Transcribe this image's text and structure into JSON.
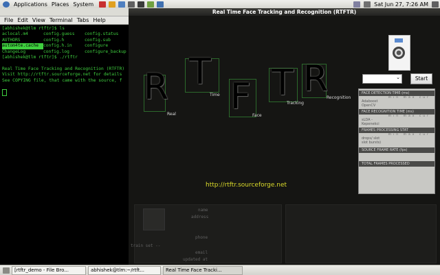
{
  "top_panel": {
    "menus": [
      "Applications",
      "Places",
      "System"
    ],
    "clock": "Sat Jun 27,  7:26 AM"
  },
  "terminal": {
    "menu": [
      "File",
      "Edit",
      "View",
      "Terminal",
      "Tabs",
      "Help"
    ],
    "prompt1": "[abhishek@tlm rtftr]$ ls",
    "ls": [
      [
        "aclocal.m4",
        "config.guess",
        "config.status"
      ],
      [
        "AUTHORS",
        "config.h",
        "config.sub"
      ],
      [
        "autom4te.cache",
        "config.h.in",
        "configure"
      ],
      [
        "ChangeLog",
        "config.log",
        "configure_backup"
      ]
    ],
    "prompt2": "[abhishek@tlm rtftr]$ ./rtftr",
    "out": [
      "Real Time Face Tracking and Recognition (RTFTR)",
      "Visit http://rtftr.sourceforge.net for details",
      "See COPYING file, that came with the source, f"
    ]
  },
  "app": {
    "title": "Real Time Face Tracking and Recognition (RTFTR)",
    "letters": [
      "R",
      "T",
      "F",
      "T",
      "R"
    ],
    "words": [
      "Real",
      "Time",
      "Face",
      "Tracking",
      "Recognition"
    ],
    "url": "http://rtftr.sourceforge.net",
    "start": "Start",
    "stats": {
      "h1": "FACE DETECTION TIME (ms)",
      "cols": "min  max  cur",
      "r1a": "Adaboost",
      "r1b": "OpenCV",
      "h2": "FACE RECOGNITION TIME (ms)",
      "r2a": "sLDA -",
      "r2b": "Kepenekci",
      "h3": "FRAMES PROCESSING STAT",
      "r3a": "drops/ slot",
      "r3b": "slot bursts)",
      "h4": "SOURCE FRAME RATE (fps)",
      "h5": "TOTAL FRAMES PROCESSED"
    },
    "form": {
      "name": "name",
      "address": "address",
      "phone": "phone",
      "email": "email",
      "updated": "updated at",
      "train": "train set --"
    }
  },
  "taskbar": [
    "[rtftr_demo - File Bro...",
    "abhishek@tlm:~/rtft...",
    "Real Time Face Tracki..."
  ]
}
